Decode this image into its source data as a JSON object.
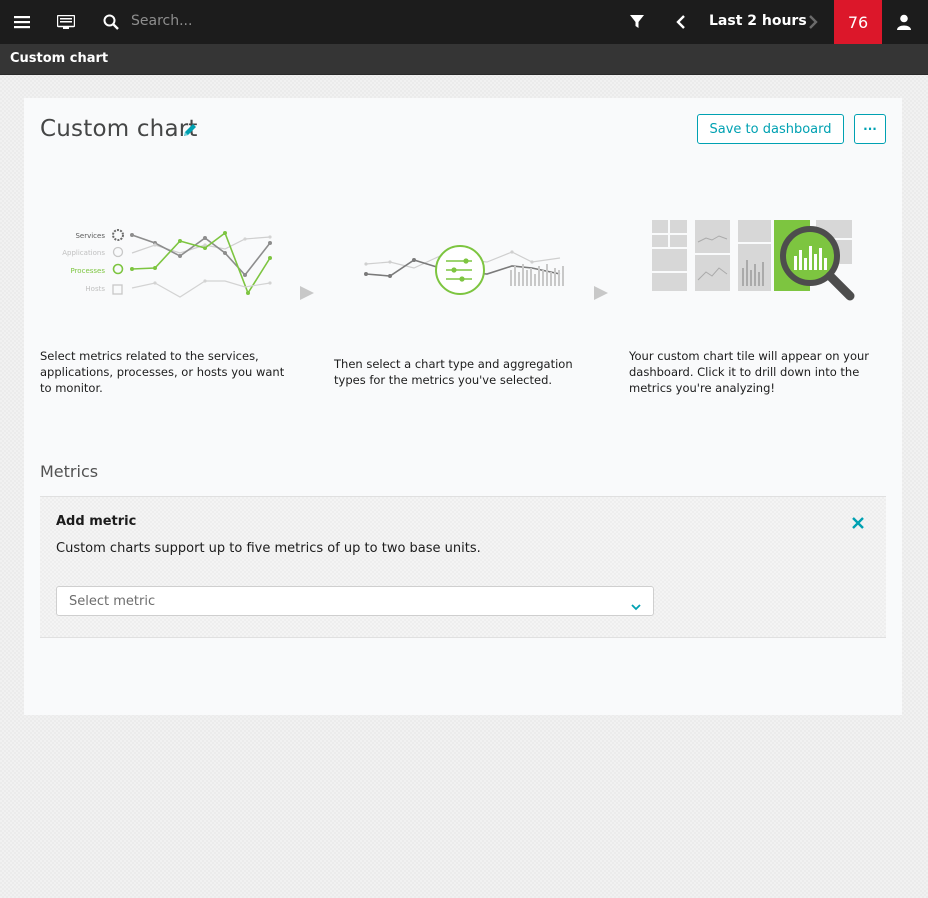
{
  "topbar": {
    "search_placeholder": "Search...",
    "timeframe": "Last 2 hours",
    "problem_count": "76"
  },
  "breadcrumb": "Custom chart",
  "page": {
    "title": "Custom chart",
    "save_label": "Save to dashboard",
    "more_label": "···"
  },
  "illustration": {
    "legend": [
      "Services",
      "Applications",
      "Processes",
      "Hosts"
    ]
  },
  "steps": [
    {
      "text": "Select metrics related to the services, applications, processes, or hosts you want to monitor."
    },
    {
      "text": "Then select a chart type and aggregation types for the metrics you've selected."
    },
    {
      "text": "Your custom chart tile will appear on your dashboard. Click it to drill down into the metrics you're analyzing!"
    }
  ],
  "metrics": {
    "heading": "Metrics",
    "add_title": "Add metric",
    "add_description": "Custom charts support up to five metrics of up to two base units.",
    "select_placeholder": "Select metric"
  },
  "colors": {
    "accent": "#00a1b2",
    "green": "#7dc540",
    "problem_red": "#dc172a",
    "topbar": "#1c1c1c"
  }
}
